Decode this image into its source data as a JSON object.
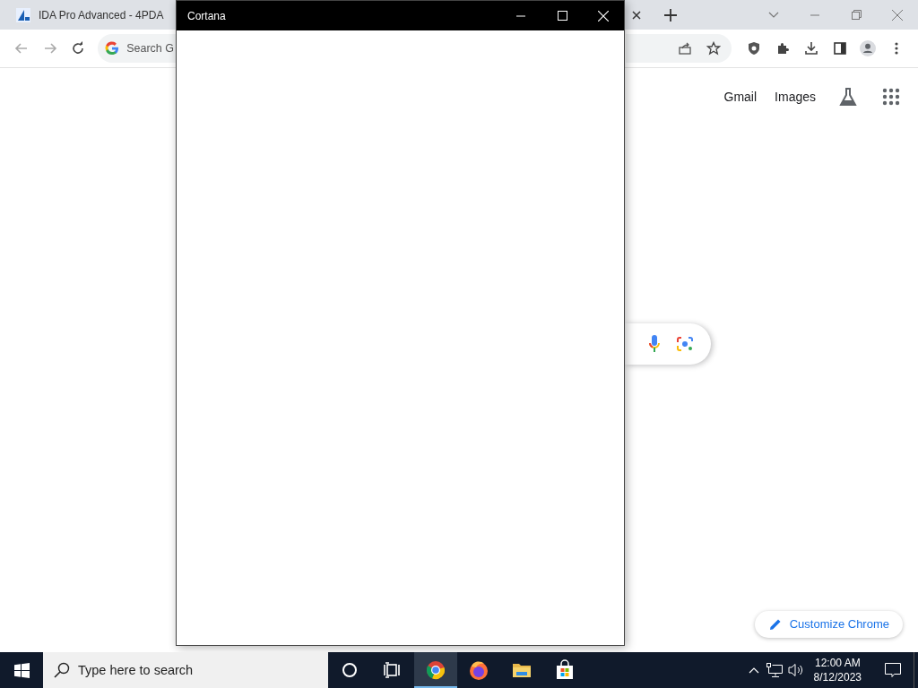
{
  "browser": {
    "tabs": [
      {
        "title": "IDA Pro Advanced - 4PDA",
        "selected": false
      }
    ],
    "address_bar": {
      "text": "Search G"
    },
    "header_links": [
      "Gmail",
      "Images"
    ],
    "customize_button": "Customize Chrome"
  },
  "cortana_window": {
    "title": "Cortana"
  },
  "taskbar": {
    "search": {
      "placeholder": "Type here to search"
    },
    "apps": [
      {
        "kind": "cortana",
        "selected": false
      },
      {
        "kind": "taskview",
        "selected": false
      },
      {
        "kind": "chrome",
        "selected": true
      },
      {
        "kind": "firefox",
        "selected": false
      },
      {
        "kind": "explorer",
        "selected": false
      },
      {
        "kind": "store",
        "selected": false
      }
    ],
    "clock": {
      "time": "12:00 AM",
      "date": "8/12/2023"
    }
  }
}
